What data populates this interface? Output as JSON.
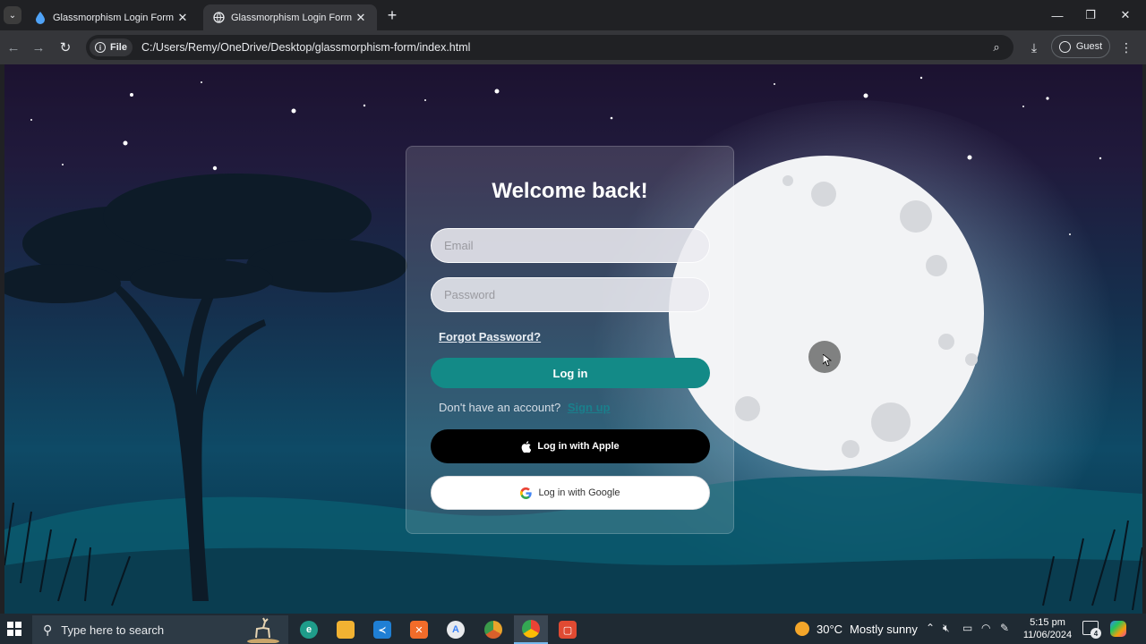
{
  "browser": {
    "tabs": [
      {
        "label": "Glassmorphism Login Form Usi",
        "active": false
      },
      {
        "label": "Glassmorphism Login Form",
        "active": true
      }
    ],
    "chip_label": "File",
    "url": "C:/Users/Remy/OneDrive/Desktop/glassmorphism-form/index.html",
    "profile_label": "Guest"
  },
  "page": {
    "title": "Welcome back!",
    "email_placeholder": "Email",
    "password_placeholder": "Password",
    "forgot_label": "Forgot Password?",
    "login_label": "Log in",
    "signup_prompt": "Don't have an account?",
    "signup_link": "Sign up",
    "apple_label": "Log in with Apple",
    "google_label": "Log in with Google"
  },
  "taskbar": {
    "search_placeholder": "Type here to search",
    "apps": [
      {
        "name": "edge",
        "color": "#1f9c8a",
        "glyph": "e"
      },
      {
        "name": "file-explorer",
        "color": "#f1b232",
        "glyph": "▭"
      },
      {
        "name": "vscode",
        "color": "#1f7fd4",
        "glyph": "≺"
      },
      {
        "name": "xampp",
        "color": "#f26c2a",
        "glyph": "✕"
      },
      {
        "name": "android-studio",
        "color": "#e8eaed",
        "glyph": "A"
      },
      {
        "name": "chrome-canary",
        "color": "#e9a42b",
        "glyph": "●"
      },
      {
        "name": "chrome",
        "color": "#3a8fd8",
        "glyph": "●"
      },
      {
        "name": "recorder",
        "color": "#e04a32",
        "glyph": "▢"
      }
    ],
    "weather_temp": "30°C",
    "weather_cond": "Mostly sunny",
    "time": "5:15 pm",
    "date": "11/06/2024",
    "notification_count": "4"
  }
}
